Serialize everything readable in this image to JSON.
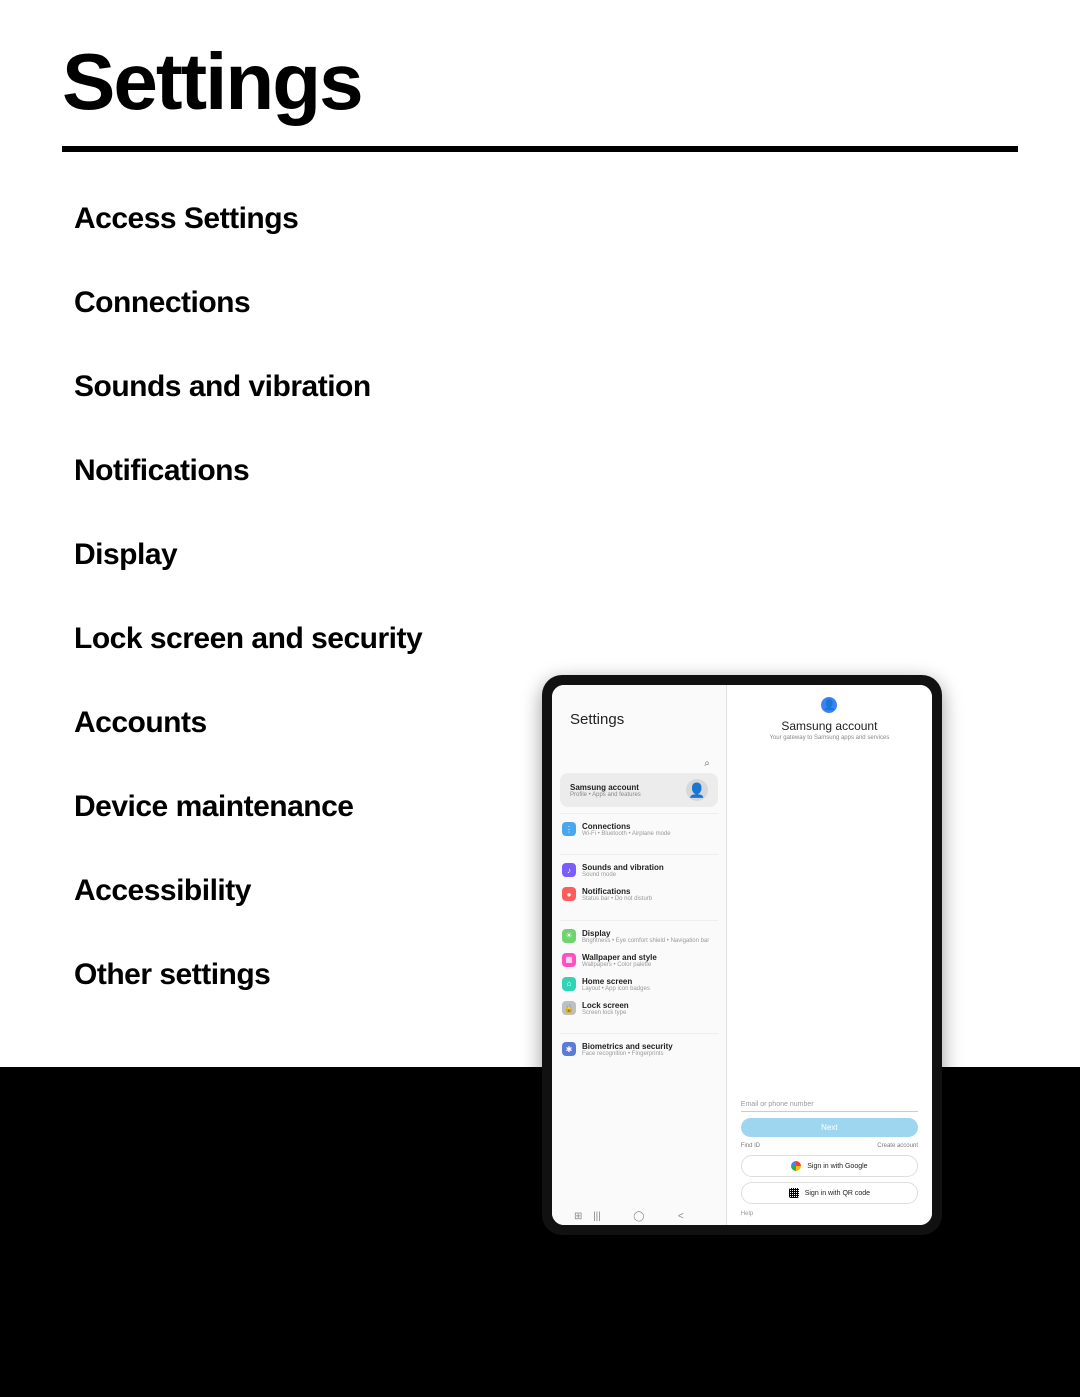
{
  "doc": {
    "title": "Settings",
    "toc": [
      "Access Settings",
      "Connections",
      "Sounds and vibration",
      "Notifications",
      "Display",
      "Lock screen and security",
      "Accounts",
      "Device maintenance",
      "Accessibility",
      "Other settings"
    ]
  },
  "tablet": {
    "left": {
      "heading": "Settings",
      "search_icon": "⌕",
      "samsung_account": {
        "title": "Samsung account",
        "sub": "Profile • Apps and features",
        "avatar_glyph": "👤"
      },
      "groups": [
        [
          {
            "icon_color": "blue",
            "glyph": "⋮",
            "title": "Connections",
            "sub": "Wi-Fi • Bluetooth • Airplane mode"
          }
        ],
        [
          {
            "icon_color": "purple",
            "glyph": "♪",
            "title": "Sounds and vibration",
            "sub": "Sound mode"
          },
          {
            "icon_color": "red",
            "glyph": "●",
            "title": "Notifications",
            "sub": "Status bar • Do not disturb"
          }
        ],
        [
          {
            "icon_color": "green",
            "glyph": "☀",
            "title": "Display",
            "sub": "Brightness • Eye comfort shield • Navigation bar"
          },
          {
            "icon_color": "pink",
            "glyph": "▦",
            "title": "Wallpaper and style",
            "sub": "Wallpapers • Color palette"
          },
          {
            "icon_color": "teal",
            "glyph": "⌂",
            "title": "Home screen",
            "sub": "Layout • App icon badges"
          },
          {
            "icon_color": "gray",
            "glyph": "🔒",
            "title": "Lock screen",
            "sub": "Screen lock type"
          }
        ],
        [
          {
            "icon_color": "navy",
            "glyph": "✱",
            "title": "Biometrics and security",
            "sub": "Face recognition • Fingerprints"
          }
        ]
      ]
    },
    "right": {
      "icon_glyph": "👤",
      "title": "Samsung account",
      "subtitle": "Your gateway to Samsung apps and services",
      "input_placeholder": "Email or phone number",
      "next_label": "Next",
      "find_id": "Find ID",
      "create_account": "Create account",
      "google_label": "Sign in with Google",
      "qr_label": "Sign in with QR code",
      "help": "Help"
    },
    "nav": {
      "tray": "⊞",
      "recents": "|||",
      "home": "◯",
      "back": "<"
    }
  }
}
